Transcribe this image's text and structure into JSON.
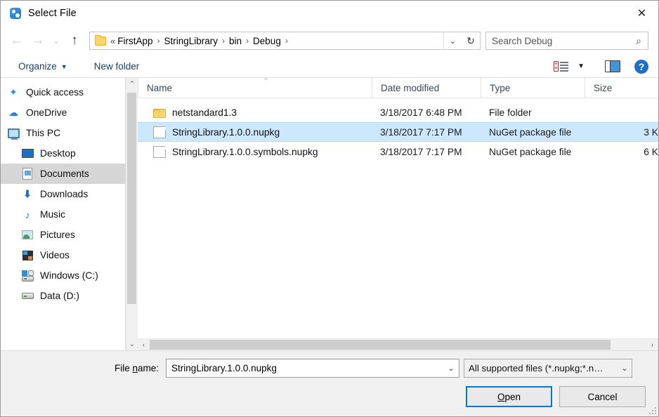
{
  "window": {
    "title": "Select File",
    "icon": "app-icon",
    "close_label": "✕"
  },
  "navbar": {
    "back_icon": "←",
    "forward_icon": "→",
    "recent_icon": "⌄",
    "up_icon": "↑",
    "folder_icon": "folder-icon",
    "path_prefix": "«",
    "breadcrumbs": [
      "FirstApp",
      "StringLibrary",
      "bin",
      "Debug"
    ],
    "separator": "›",
    "dropdown_icon": "⌄",
    "refresh_icon": "↻",
    "search_placeholder": "Search Debug",
    "search_icon": "⌕"
  },
  "commandbar": {
    "organize_label": "Organize",
    "organize_caret": "▼",
    "new_folder_label": "New folder",
    "view_caret": "▼",
    "help_label": "?"
  },
  "sidebar": {
    "items": [
      {
        "label": "Quick access",
        "icon": "star-icon",
        "indent": false,
        "selected": false
      },
      {
        "label": "OneDrive",
        "icon": "cloud-icon",
        "indent": false,
        "selected": false
      },
      {
        "label": "This PC",
        "icon": "monitor-icon",
        "indent": false,
        "selected": false
      },
      {
        "label": "Desktop",
        "icon": "desktop-icon",
        "indent": true,
        "selected": false
      },
      {
        "label": "Documents",
        "icon": "documents-icon",
        "indent": true,
        "selected": true
      },
      {
        "label": "Downloads",
        "icon": "download-arrow-icon",
        "indent": true,
        "selected": false
      },
      {
        "label": "Music",
        "icon": "music-note-icon",
        "indent": true,
        "selected": false
      },
      {
        "label": "Pictures",
        "icon": "picture-icon",
        "indent": true,
        "selected": false
      },
      {
        "label": "Videos",
        "icon": "video-icon",
        "indent": true,
        "selected": false
      },
      {
        "label": "Windows (C:)",
        "icon": "windows-drive-icon",
        "indent": true,
        "selected": false
      },
      {
        "label": "Data (D:)",
        "icon": "drive-icon",
        "indent": true,
        "selected": false
      }
    ],
    "scroll_up_icon": "⌃",
    "scroll_down_icon": "⌄"
  },
  "filelist": {
    "columns": [
      "Name",
      "Date modified",
      "Type",
      "Size"
    ],
    "sort_indicator": "⌃",
    "rows": [
      {
        "name": "netstandard1.3",
        "date": "3/18/2017 6:48 PM",
        "type": "File folder",
        "size": "",
        "icon": "folder-icon",
        "selected": false
      },
      {
        "name": "StringLibrary.1.0.0.nupkg",
        "date": "3/18/2017 7:17 PM",
        "type": "NuGet package file",
        "size": "3 K",
        "icon": "file-icon",
        "selected": true
      },
      {
        "name": "StringLibrary.1.0.0.symbols.nupkg",
        "date": "3/18/2017 7:17 PM",
        "type": "NuGet package file",
        "size": "6 K",
        "icon": "file-icon",
        "selected": false
      }
    ],
    "hscroll_left_icon": "‹",
    "hscroll_right_icon": "›"
  },
  "footer": {
    "filename_label_pre": "File ",
    "filename_label_accel": "n",
    "filename_label_post": "ame:",
    "filename_value": "StringLibrary.1.0.0.nupkg",
    "filename_caret": "⌄",
    "filter_value": "All supported files (*.nupkg;*.n…",
    "filter_caret": "⌄",
    "open_label_pre": "",
    "open_label_accel": "O",
    "open_label_post": "pen",
    "cancel_label": "Cancel"
  },
  "colors": {
    "accent": "#0078d7",
    "selection": "#cce8ff",
    "sidebar_selection": "#d6d6d6",
    "folder": "#fbd46a",
    "footer_bg": "#f0f0f0"
  }
}
